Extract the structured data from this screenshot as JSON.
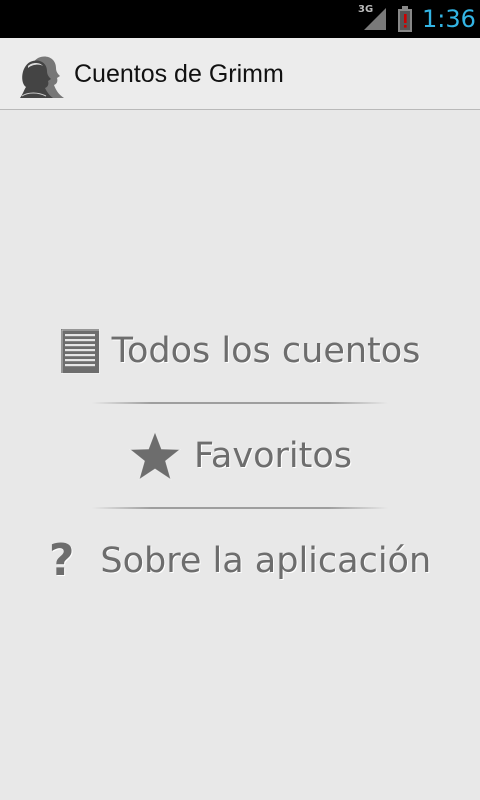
{
  "status_bar": {
    "network": "3G",
    "time": "1:36",
    "colors": {
      "time": "#33b5e5",
      "battery_alert": "#cc0000"
    },
    "icons": [
      "signal-icon",
      "battery-alert-icon"
    ]
  },
  "action_bar": {
    "title": "Cuentos de Grimm",
    "icon": "grimm-brothers-portrait-icon"
  },
  "menu": {
    "items": [
      {
        "label": "Todos los cuentos",
        "icon": "document-list-icon"
      },
      {
        "label": "Favoritos",
        "icon": "star-icon"
      },
      {
        "label": "Sobre la aplicación",
        "icon": "question-mark-icon",
        "glyph": "?"
      }
    ],
    "colors": {
      "text": "#6d6d6d",
      "background": "#e8e8e8"
    }
  }
}
